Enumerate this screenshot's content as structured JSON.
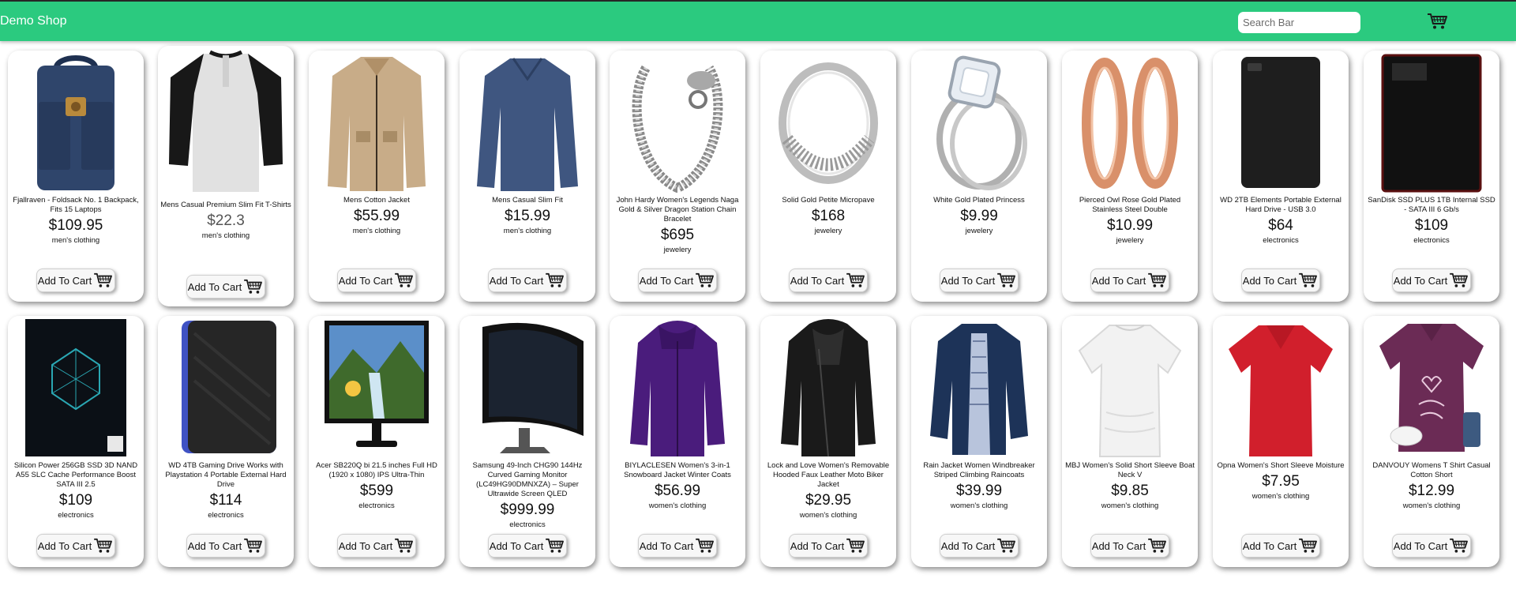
{
  "header": {
    "brand": "Demo Shop",
    "search_placeholder": "Search Bar",
    "cart_icon": "cart-icon"
  },
  "button_label": "Add To Cart",
  "products": [
    {
      "title": "Fjallraven - Foldsack No. 1 Backpack, Fits 15 Laptops",
      "price": "$109.95",
      "category": "men's clothing",
      "image": "backpack"
    },
    {
      "title": "Mens Casual Premium Slim Fit T-Shirts",
      "price": "$22.3",
      "category": "men's clothing",
      "image": "raglan-tshirt"
    },
    {
      "title": "Mens Cotton Jacket",
      "price": "$55.99",
      "category": "men's clothing",
      "image": "khaki-jacket"
    },
    {
      "title": "Mens Casual Slim Fit",
      "price": "$15.99",
      "category": "men's clothing",
      "image": "longsleeve-shirt"
    },
    {
      "title": "John Hardy Women's Legends Naga Gold & Silver Dragon Station Chain Bracelet",
      "price": "$695",
      "category": "jewelery",
      "image": "dragon-bracelet"
    },
    {
      "title": "Solid Gold Petite Micropave",
      "price": "$168",
      "category": "jewelery",
      "image": "silver-ring"
    },
    {
      "title": "White Gold Plated Princess",
      "price": "$9.99",
      "category": "jewelery",
      "image": "diamond-ring"
    },
    {
      "title": "Pierced Owl Rose Gold Plated Stainless Steel Double",
      "price": "$10.99",
      "category": "jewelery",
      "image": "rose-gold-tunnels"
    },
    {
      "title": "WD 2TB Elements Portable External Hard Drive - USB 3.0",
      "price": "$64",
      "category": "electronics",
      "image": "wd-hdd-black"
    },
    {
      "title": "SanDisk SSD PLUS 1TB Internal SSD - SATA III 6 Gb/s",
      "price": "$109",
      "category": "electronics",
      "image": "sandisk-ssd"
    },
    {
      "title": "Silicon Power 256GB SSD 3D NAND A55 SLC Cache Performance Boost SATA III 2.5",
      "price": "$109",
      "category": "electronics",
      "image": "silicon-power-ssd"
    },
    {
      "title": "WD 4TB Gaming Drive Works with Playstation 4 Portable External Hard Drive",
      "price": "$114",
      "category": "electronics",
      "image": "wd-gaming-drive"
    },
    {
      "title": "Acer SB220Q bi 21.5 inches Full HD (1920 x 1080) IPS Ultra-Thin",
      "price": "$599",
      "category": "electronics",
      "image": "acer-monitor"
    },
    {
      "title": "Samsung 49-Inch CHG90 144Hz Curved Gaming Monitor (LC49HG90DMNXZA) – Super Ultrawide Screen QLED",
      "price": "$999.99",
      "category": "electronics",
      "image": "samsung-curved-monitor"
    },
    {
      "title": "BIYLACLESEN Women's 3-in-1 Snowboard Jacket Winter Coats",
      "price": "$56.99",
      "category": "women's clothing",
      "image": "purple-jacket"
    },
    {
      "title": "Lock and Love Women's Removable Hooded Faux Leather Moto Biker Jacket",
      "price": "$29.95",
      "category": "women's clothing",
      "image": "leather-jacket"
    },
    {
      "title": "Rain Jacket Women Windbreaker Striped Climbing Raincoats",
      "price": "$39.99",
      "category": "women's clothing",
      "image": "navy-raincoat"
    },
    {
      "title": "MBJ Women's Solid Short Sleeve Boat Neck V",
      "price": "$9.85",
      "category": "women's clothing",
      "image": "white-top"
    },
    {
      "title": "Opna Women's Short Sleeve Moisture",
      "price": "$7.95",
      "category": "women's clothing",
      "image": "red-tshirt"
    },
    {
      "title": "DANVOUY Womens T Shirt Casual Cotton Short",
      "price": "$12.99",
      "category": "women's clothing",
      "image": "purple-be-kind-tshirt"
    }
  ]
}
